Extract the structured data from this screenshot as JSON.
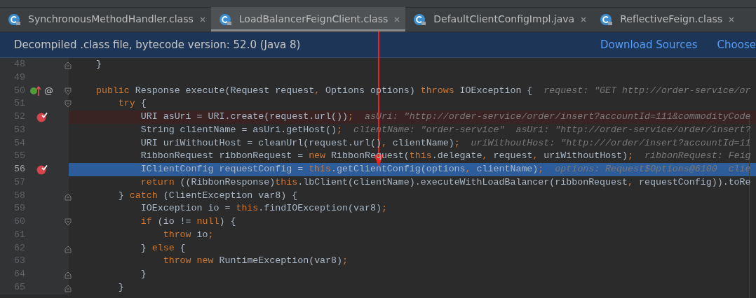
{
  "tabs": [
    {
      "label": "SynchronousMethodHandler.class",
      "selected": false
    },
    {
      "label": "LoadBalancerFeignClient.class",
      "selected": true
    },
    {
      "label": "DefaultClientConfigImpl.java",
      "selected": false
    },
    {
      "label": "ReflectiveFeign.class",
      "selected": false
    }
  ],
  "info_bar": {
    "message": "Decompiled .class file, bytecode version: 52.0 (Java 8)",
    "actions": [
      "Download Sources",
      "Choose"
    ]
  },
  "lines": [
    {
      "number": "48",
      "fold_close": true,
      "tokens": [
        {
          "kind": "text",
          "text": "    }"
        }
      ]
    },
    {
      "number": "49"
    },
    {
      "number": "50",
      "fold_open": true,
      "override": true,
      "gutter_mark": "@",
      "tokens": [
        {
          "kind": "keyword",
          "text": "    public"
        },
        {
          "kind": "text",
          "text": " Response execute(Request request"
        },
        {
          "kind": "keyword",
          "text": ","
        },
        {
          "kind": "text",
          "text": " Options options) "
        },
        {
          "kind": "keyword",
          "text": "throws"
        },
        {
          "kind": "text",
          "text": " IOException {  "
        },
        {
          "kind": "hint",
          "text": "request: \"GET http://order-service/or"
        }
      ]
    },
    {
      "number": "51",
      "fold_open": true,
      "tokens": [
        {
          "kind": "keyword",
          "text": "        try"
        },
        {
          "kind": "text",
          "text": " {"
        }
      ]
    },
    {
      "number": "52",
      "breakpoint": true,
      "current": false,
      "tokens": [
        {
          "kind": "text",
          "text": "            URI asUri = URI.create(request.url())"
        },
        {
          "kind": "keyword",
          "text": ";  "
        },
        {
          "kind": "hint",
          "text": "asUri: \"http://order-service/order/insert?accountId=111&commodityCode"
        }
      ]
    },
    {
      "number": "53",
      "tokens": [
        {
          "kind": "text",
          "text": "            String clientName = asUri.getHost()"
        },
        {
          "kind": "keyword",
          "text": ";  "
        },
        {
          "kind": "hint",
          "text": "clientName: \"order-service\"  asUri: \"http://order-service/order/insert?"
        }
      ]
    },
    {
      "number": "54",
      "tokens": [
        {
          "kind": "text",
          "text": "            URI uriWithoutHost = cleanUrl(request.url()"
        },
        {
          "kind": "keyword",
          "text": ","
        },
        {
          "kind": "text",
          "text": " clientName)"
        },
        {
          "kind": "keyword",
          "text": ";  "
        },
        {
          "kind": "hint",
          "text": "uriWithoutHost: \"http:///order/insert?accountId=11"
        }
      ]
    },
    {
      "number": "55",
      "tokens": [
        {
          "kind": "text",
          "text": "            RibbonRequest ribbonRequest = "
        },
        {
          "kind": "keyword",
          "text": "new"
        },
        {
          "kind": "text",
          "text": " RibbonRequest("
        },
        {
          "kind": "keyword",
          "text": "this"
        },
        {
          "kind": "text",
          "text": ".delegate"
        },
        {
          "kind": "keyword",
          "text": ","
        },
        {
          "kind": "text",
          "text": " request"
        },
        {
          "kind": "keyword",
          "text": ","
        },
        {
          "kind": "text",
          "text": " uriWithoutHost)"
        },
        {
          "kind": "keyword",
          "text": ";  "
        },
        {
          "kind": "hint",
          "text": "ribbonRequest: Feig"
        }
      ]
    },
    {
      "number": "56",
      "breakpoint": true,
      "current": true,
      "tokens": [
        {
          "kind": "text",
          "text": "            IClientConfig requestConfig = "
        },
        {
          "kind": "keyword",
          "text": "this"
        },
        {
          "kind": "text",
          "text": ".getClientConfig(options"
        },
        {
          "kind": "keyword",
          "text": ","
        },
        {
          "kind": "text",
          "text": " clientName)"
        },
        {
          "kind": "keyword",
          "text": ";  "
        },
        {
          "kind": "hint",
          "text": "options: Request$Options@6100  clie"
        }
      ]
    },
    {
      "number": "57",
      "tokens": [
        {
          "kind": "keyword",
          "text": "            return"
        },
        {
          "kind": "text",
          "text": " ((RibbonResponse)"
        },
        {
          "kind": "keyword",
          "text": "this"
        },
        {
          "kind": "text",
          "text": ".lbClient(clientName).executeWithLoadBalancer(ribbonRequest"
        },
        {
          "kind": "keyword",
          "text": ","
        },
        {
          "kind": "text",
          "text": " requestConfig)).toRe"
        }
      ]
    },
    {
      "number": "58",
      "fold_close": true,
      "tokens": [
        {
          "kind": "text",
          "text": "        } "
        },
        {
          "kind": "keyword",
          "text": "catch"
        },
        {
          "kind": "text",
          "text": " (ClientException var8) {"
        }
      ]
    },
    {
      "number": "59",
      "tokens": [
        {
          "kind": "text",
          "text": "            IOException io = "
        },
        {
          "kind": "keyword",
          "text": "this"
        },
        {
          "kind": "text",
          "text": ".findIOException(var8)"
        },
        {
          "kind": "keyword",
          "text": ";"
        }
      ]
    },
    {
      "number": "60",
      "fold_open": true,
      "tokens": [
        {
          "kind": "keyword",
          "text": "            if"
        },
        {
          "kind": "text",
          "text": " (io != "
        },
        {
          "kind": "keyword",
          "text": "null"
        },
        {
          "kind": "text",
          "text": ") {"
        }
      ]
    },
    {
      "number": "61",
      "tokens": [
        {
          "kind": "keyword",
          "text": "                throw"
        },
        {
          "kind": "text",
          "text": " io"
        },
        {
          "kind": "keyword",
          "text": ";"
        }
      ]
    },
    {
      "number": "62",
      "fold_close": true,
      "tokens": [
        {
          "kind": "text",
          "text": "            } "
        },
        {
          "kind": "keyword",
          "text": "else"
        },
        {
          "kind": "text",
          "text": " {"
        }
      ]
    },
    {
      "number": "63",
      "tokens": [
        {
          "kind": "keyword",
          "text": "                throw new"
        },
        {
          "kind": "text",
          "text": " RuntimeException(var8)"
        },
        {
          "kind": "keyword",
          "text": ";"
        }
      ]
    },
    {
      "number": "64",
      "fold_close": true,
      "tokens": [
        {
          "kind": "text",
          "text": "            }"
        }
      ]
    },
    {
      "number": "65",
      "fold_close": true,
      "tokens": [
        {
          "kind": "text",
          "text": "        }"
        }
      ]
    }
  ]
}
